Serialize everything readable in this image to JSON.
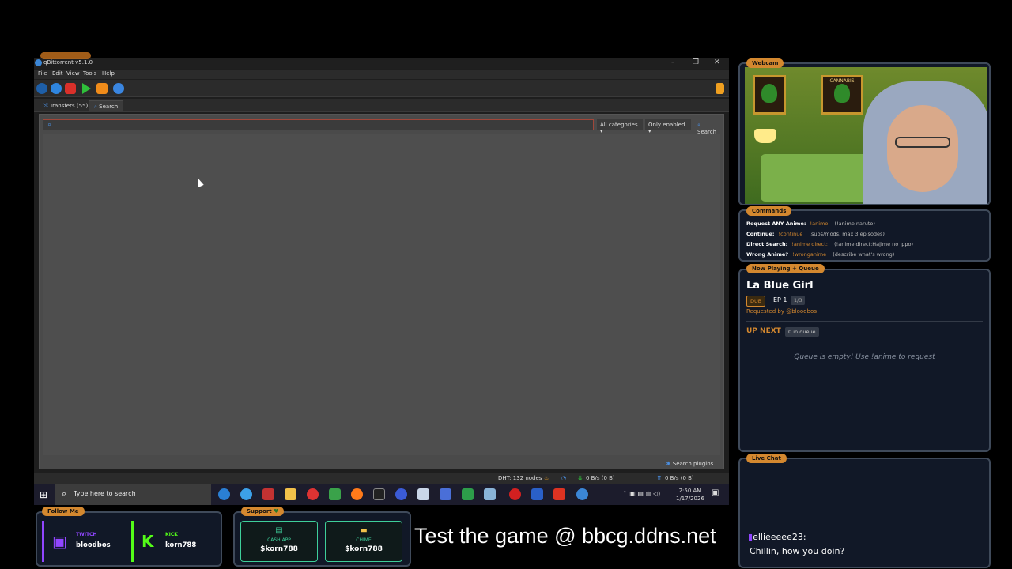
{
  "window": {
    "title": "qBittorrent v5.1.0",
    "menu": [
      "File",
      "Edit",
      "View",
      "Tools",
      "Help"
    ],
    "tabs": [
      {
        "label": "Transfers (55)"
      },
      {
        "label": "Search"
      }
    ],
    "search": {
      "placeholder": "",
      "category": "All categories",
      "plugins_filter": "Only enabled",
      "button": "Search",
      "plugins_button": "Search plugins..."
    },
    "status": {
      "dht": "DHT: 132 nodes",
      "download": "0 B/s (0 B)",
      "upload": "0 B/s (0 B)"
    }
  },
  "taskbar": {
    "search_placeholder": "Type here to search",
    "time": "2:50 AM",
    "date": "1/17/2026"
  },
  "overlay": {
    "webcam_label": "Webcam",
    "webcam_posters": [
      "",
      "CANNABIS"
    ],
    "commands_label": "Commands",
    "commands": [
      {
        "key": "Request ANY Anime:",
        "cmd": "!anime",
        "desc": "(!anime naruto)"
      },
      {
        "key": "Continue:",
        "cmd": "!continue",
        "desc": "(subs/mods, max 3 episodes)"
      },
      {
        "key": "Direct Search:",
        "cmd": "!anime direct:",
        "desc": "(!anime direct:Hajime no Ippo)"
      },
      {
        "key": "Wrong Anime?",
        "cmd": "!wronganime",
        "desc": "(describe what's wrong)"
      }
    ],
    "now_playing_label": "Now Playing + Queue",
    "now_playing": {
      "title": "La Blue Girl",
      "dub": "DUB",
      "episode": "EP 1",
      "progress": "1/3",
      "requested_by": "Requested by @bloodbos",
      "up_next": "UP NEXT",
      "queue_count": "0 in queue",
      "empty": "Queue is empty! Use !anime to request"
    },
    "live_chat_label": "Live Chat",
    "chat": {
      "user": "ellieeeee23:",
      "message": "Chillin, how you doin?"
    },
    "follow_label": "Follow Me",
    "twitch": {
      "label": "TWITCH",
      "name": "bloodbos"
    },
    "kick": {
      "label": "KICK",
      "name": "korn788"
    },
    "support_label": "Support",
    "cashapp": {
      "label": "CASH APP",
      "name": "$korn788"
    },
    "chime": {
      "label": "CHIME",
      "name": "$korn788"
    },
    "banner": "Test the game @ bbcg.ddns.net"
  },
  "colors": {
    "accent": "#d4882f",
    "twitch": "#9146ff",
    "kick": "#53fc18",
    "cashapp": "#3ecf9a"
  }
}
